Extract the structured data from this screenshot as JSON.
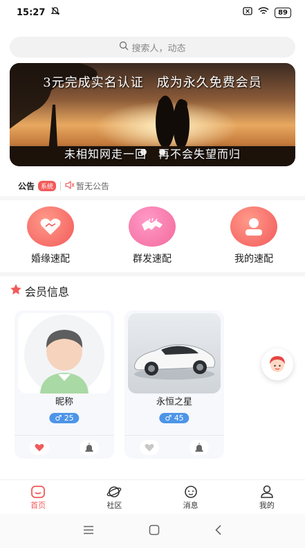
{
  "status_bar": {
    "time": "15:27",
    "battery": "89"
  },
  "search": {
    "placeholder": "搜索人，动态"
  },
  "banner": {
    "line1": "3元完成实名认证　成为永久免费会员",
    "line2": "未相知网走一回　再不会失望而归"
  },
  "notice": {
    "title": "公告",
    "badge": "系统",
    "text": "暂无公告"
  },
  "quick_actions": [
    {
      "label": "婚缘速配",
      "icon": "heart-handshake-icon"
    },
    {
      "label": "群发速配",
      "icon": "handshake-icon"
    },
    {
      "label": "我的速配",
      "icon": "user-icon"
    }
  ],
  "section": {
    "title": "会员信息"
  },
  "members": [
    {
      "name": "昵称",
      "age": "25",
      "gender": "male"
    },
    {
      "name": "永恒之星",
      "age": "45",
      "gender": "male"
    }
  ],
  "tabbar": [
    {
      "label": "首页",
      "icon": "home-icon",
      "active": true
    },
    {
      "label": "社区",
      "icon": "planet-icon",
      "active": false
    },
    {
      "label": "消息",
      "icon": "chat-icon",
      "active": false
    },
    {
      "label": "我的",
      "icon": "profile-icon",
      "active": false
    }
  ],
  "colors": {
    "accent": "#f25a5a",
    "age_badge": "#4d95e8",
    "quick_gradient_start": "#ff9a8a",
    "quick_gradient_end": "#f25a5a"
  }
}
